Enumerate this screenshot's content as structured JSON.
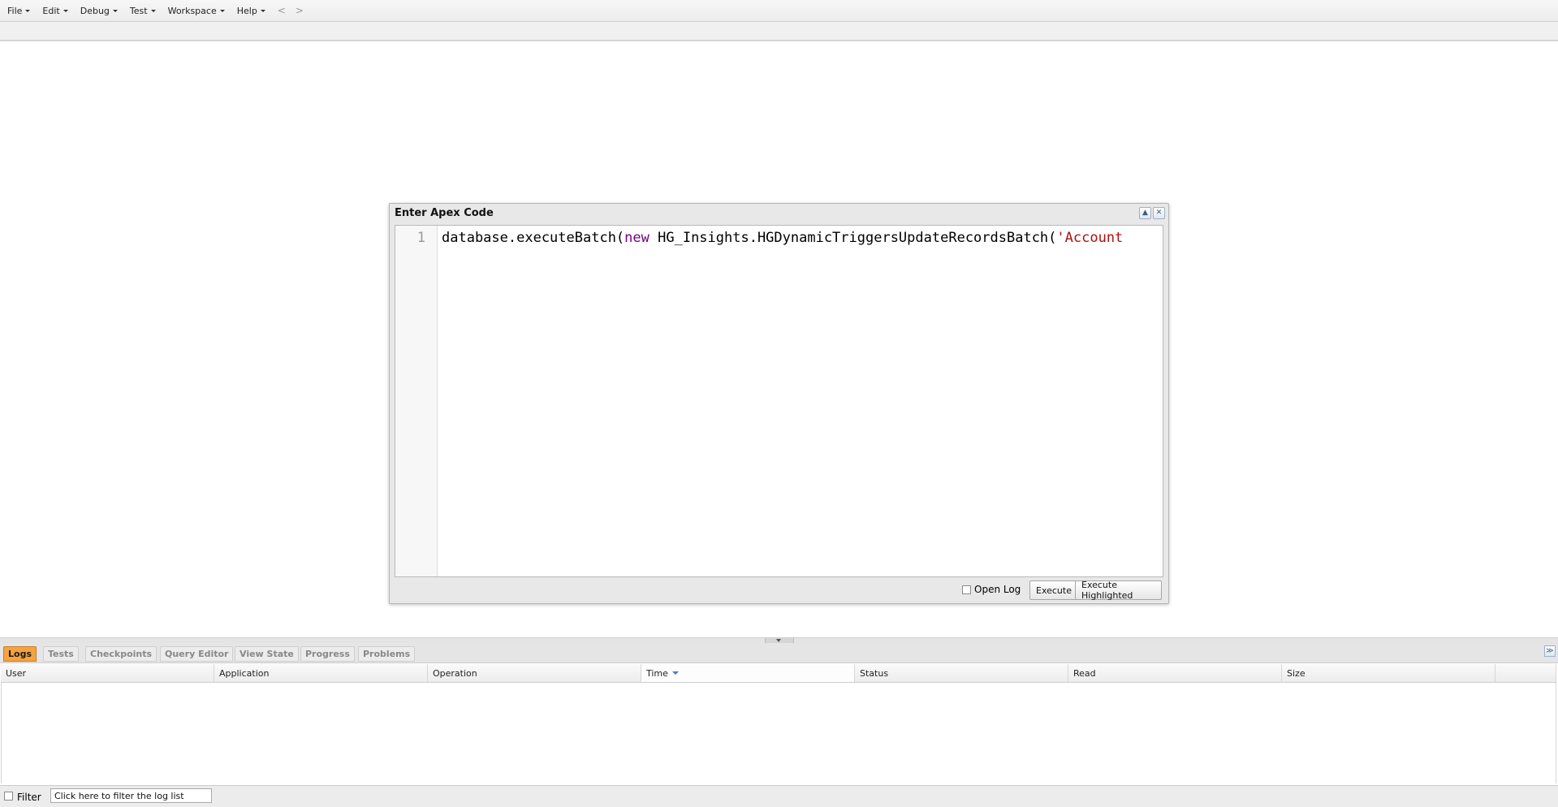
{
  "menubar": {
    "items": [
      "File",
      "Edit",
      "Debug",
      "Test",
      "Workspace",
      "Help"
    ],
    "back": "<",
    "forward": ">"
  },
  "dialog": {
    "title": "Enter Apex Code",
    "line_number": "1",
    "code": {
      "prefix": "database.executeBatch(",
      "keyword": "new",
      "middle": " HG_Insights.HGDynamicTriggersUpdateRecordsBatch(",
      "string": "'Account"
    },
    "open_log_label": "Open Log",
    "open_log_checked": false,
    "execute_label": "Execute",
    "execute_highlighted_label": "Execute Highlighted"
  },
  "tabs": [
    "Logs",
    "Tests",
    "Checkpoints",
    "Query Editor",
    "View State",
    "Progress",
    "Problems"
  ],
  "active_tab": "Logs",
  "logs_table": {
    "columns": [
      "User",
      "Application",
      "Operation",
      "Time",
      "Status",
      "Read",
      "Size"
    ],
    "sorted_column": "Time",
    "sort_direction": "descending",
    "rows": []
  },
  "filter": {
    "label": "Filter",
    "checked": false,
    "placeholder": "Click here to filter the log list"
  },
  "colors": {
    "active_tab": "#f4a340",
    "keyword": "#770088",
    "string": "#aa1111"
  }
}
